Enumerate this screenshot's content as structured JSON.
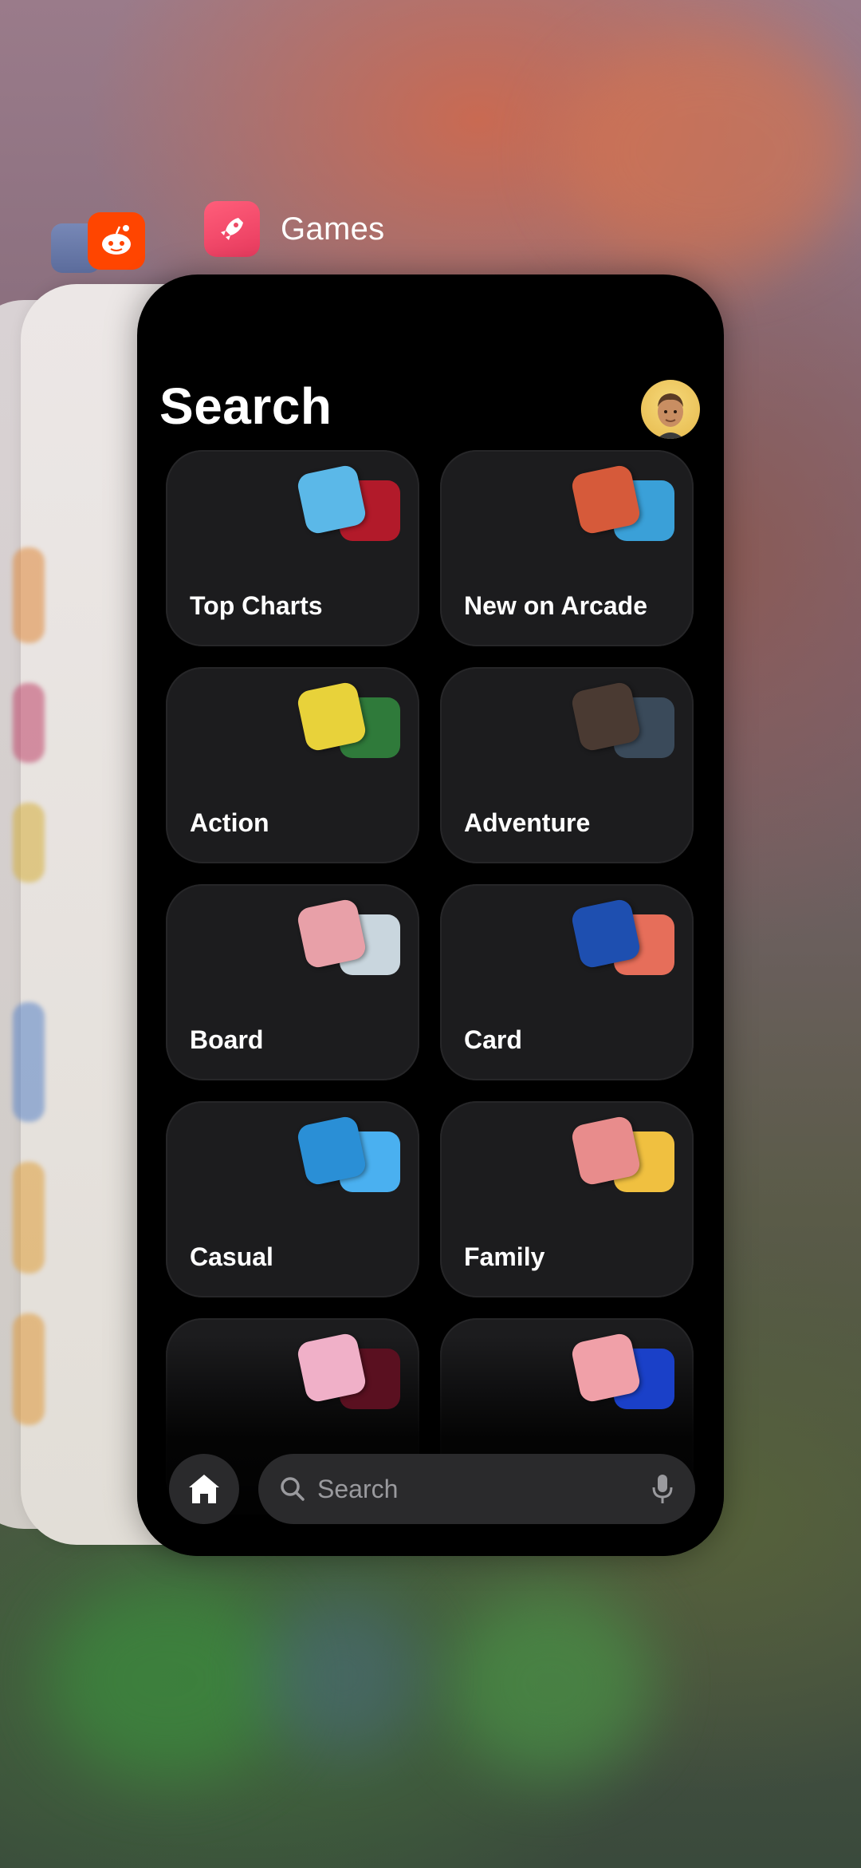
{
  "switcher": {
    "apps": [
      {
        "icon": "app-store-icon"
      },
      {
        "icon": "reddit-icon"
      }
    ],
    "current_app": {
      "title": "Games",
      "icon": "rocket-icon"
    }
  },
  "screen": {
    "title": "Search",
    "avatar": "memoji-avatar"
  },
  "categories": [
    {
      "label": "Top Charts",
      "art": [
        "#5bb8e8",
        "#b21a2a"
      ]
    },
    {
      "label": "New on Arcade",
      "art": [
        "#d65a3a",
        "#3aa0d8"
      ]
    },
    {
      "label": "Action",
      "art": [
        "#e8d23a",
        "#2f7a3a"
      ]
    },
    {
      "label": "Adventure",
      "art": [
        "#4a3a32",
        "#3a4a5a"
      ]
    },
    {
      "label": "Board",
      "art": [
        "#e8a0a8",
        "#c9d6de"
      ]
    },
    {
      "label": "Card",
      "art": [
        "#1e4fb0",
        "#e66e5a"
      ]
    },
    {
      "label": "Casual",
      "art": [
        "#2a8fd6",
        "#4ab0f0"
      ]
    },
    {
      "label": "Family",
      "art": [
        "#e88c8c",
        "#f0c040"
      ]
    },
    {
      "label": "",
      "art": [
        "#f0b0c8",
        "#5a1020"
      ]
    },
    {
      "label": "",
      "art": [
        "#f0a0a8",
        "#1a40c8"
      ]
    }
  ],
  "bottom_bar": {
    "search_placeholder": "Search",
    "home_icon": "house-icon",
    "mic_icon": "microphone-icon"
  }
}
